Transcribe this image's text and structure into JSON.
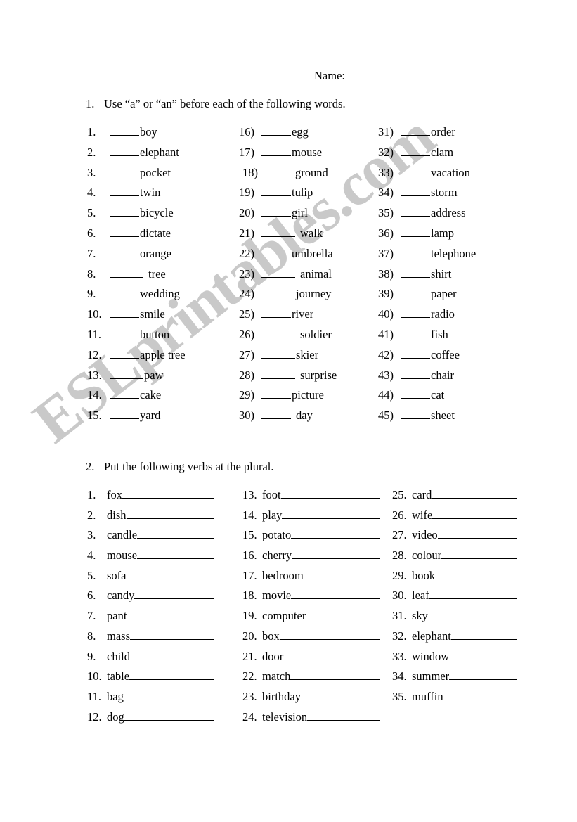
{
  "header": {
    "name_label": "Name:"
  },
  "exercise1": {
    "number": "1.",
    "instruction": "Use “a” or “an” before each of the following words.",
    "columns": [
      {
        "items": [
          {
            "label": "1.",
            "word": "boy"
          },
          {
            "label": "2.",
            "word": "elephant"
          },
          {
            "label": "3.",
            "word": "pocket"
          },
          {
            "label": "4.",
            "word": "twin"
          },
          {
            "label": "5.",
            "word": "bicycle"
          },
          {
            "label": "6.",
            "word": "dictate"
          },
          {
            "label": "7.",
            "word": "orange"
          },
          {
            "label": "8.",
            "word": "tree"
          },
          {
            "label": "9.",
            "word": "wedding"
          },
          {
            "label": "10.",
            "word": "smile"
          },
          {
            "label": "11.",
            "word": "button"
          },
          {
            "label": "12.",
            "word": "apple tree"
          },
          {
            "label": "13.",
            "word": "paw"
          },
          {
            "label": "14.",
            "word": "cake"
          },
          {
            "label": "15.",
            "word": "yard"
          }
        ]
      },
      {
        "items": [
          {
            "label": "16)",
            "word": "egg"
          },
          {
            "label": "17)",
            "word": "mouse"
          },
          {
            "label": "18)",
            "word": "ground"
          },
          {
            "label": "19)",
            "word": "tulip"
          },
          {
            "label": "20)",
            "word": "girl"
          },
          {
            "label": "21)",
            "word": "walk"
          },
          {
            "label": "22)",
            "word": "umbrella"
          },
          {
            "label": "23)",
            "word": "animal"
          },
          {
            "label": "24)",
            "word": "journey"
          },
          {
            "label": "25)",
            "word": "river"
          },
          {
            "label": "26)",
            "word": "soldier"
          },
          {
            "label": "27)",
            "word": "skier"
          },
          {
            "label": "28)",
            "word": "surprise"
          },
          {
            "label": "29)",
            "word": "picture"
          },
          {
            "label": "30)",
            "word": "day"
          }
        ]
      },
      {
        "items": [
          {
            "label": "31)",
            "word": "order"
          },
          {
            "label": "32)",
            "word": "clam"
          },
          {
            "label": "33)",
            "word": "vacation"
          },
          {
            "label": "34)",
            "word": "storm"
          },
          {
            "label": "35)",
            "word": "address"
          },
          {
            "label": "36)",
            "word": "lamp"
          },
          {
            "label": "37)",
            "word": "telephone"
          },
          {
            "label": "38)",
            "word": "shirt"
          },
          {
            "label": "39)",
            "word": "paper"
          },
          {
            "label": "40)",
            "word": "radio"
          },
          {
            "label": "41)",
            "word": "fish"
          },
          {
            "label": "42)",
            "word": "coffee"
          },
          {
            "label": "43)",
            "word": "chair"
          },
          {
            "label": "44)",
            "word": "cat"
          },
          {
            "label": "45)",
            "word": "sheet"
          }
        ]
      }
    ]
  },
  "exercise2": {
    "number": "2.",
    "instruction": "Put the following verbs at the plural.",
    "columns": [
      {
        "items": [
          {
            "label": "1.",
            "word": "fox"
          },
          {
            "label": "2.",
            "word": "dish"
          },
          {
            "label": "3.",
            "word": "candle"
          },
          {
            "label": "4.",
            "word": "mouse"
          },
          {
            "label": "5.",
            "word": "sofa"
          },
          {
            "label": "6.",
            "word": "candy"
          },
          {
            "label": "7.",
            "word": "pant"
          },
          {
            "label": "8.",
            "word": "mass"
          },
          {
            "label": "9.",
            "word": "child"
          },
          {
            "label": "10.",
            "word": "table"
          },
          {
            "label": "11.",
            "word": "bag"
          },
          {
            "label": "12.",
            "word": "dog"
          }
        ]
      },
      {
        "items": [
          {
            "label": "13.",
            "word": "foot"
          },
          {
            "label": "14.",
            "word": "play"
          },
          {
            "label": "15.",
            "word": "potato"
          },
          {
            "label": "16.",
            "word": "cherry"
          },
          {
            "label": "17.",
            "word": "bedroom"
          },
          {
            "label": "18.",
            "word": "movie"
          },
          {
            "label": "19.",
            "word": "computer"
          },
          {
            "label": "20.",
            "word": "box"
          },
          {
            "label": "21.",
            "word": "door"
          },
          {
            "label": "22.",
            "word": "match"
          },
          {
            "label": "23.",
            "word": "birthday"
          },
          {
            "label": "24.",
            "word": "television"
          }
        ]
      },
      {
        "items": [
          {
            "label": "25.",
            "word": "card"
          },
          {
            "label": "26.",
            "word": "wife"
          },
          {
            "label": "27.",
            "word": "video"
          },
          {
            "label": "28.",
            "word": "colour"
          },
          {
            "label": "29.",
            "word": "book"
          },
          {
            "label": "30.",
            "word": "leaf"
          },
          {
            "label": "31.",
            "word": "sky"
          },
          {
            "label": "32.",
            "word": "elephant"
          },
          {
            "label": "33.",
            "word": "window"
          },
          {
            "label": "34.",
            "word": "summer"
          },
          {
            "label": "35.",
            "word": "muffin"
          }
        ]
      }
    ]
  },
  "watermark": {
    "text": "ESLprintables.com",
    "color": "#c9c9c9"
  }
}
